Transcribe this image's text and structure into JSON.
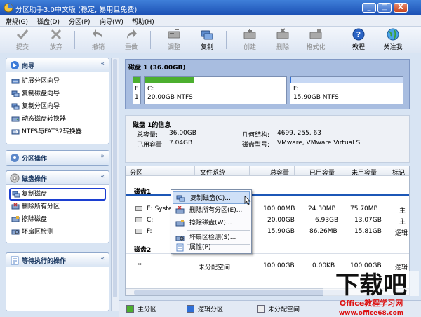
{
  "window": {
    "title": "分区助手3.0中文版 (稳定, 易用且免费)",
    "controls": [
      "_",
      "□",
      "X"
    ]
  },
  "menu": [
    "常规(G)",
    "磁盘(D)",
    "分区(P)",
    "向导(W)",
    "帮助(H)"
  ],
  "toolbar": [
    {
      "label": "提交",
      "icon": "check-icon",
      "enabled": false
    },
    {
      "label": "放弃",
      "icon": "x-icon",
      "enabled": false
    },
    {
      "label": "撤销",
      "icon": "undo-icon",
      "enabled": false
    },
    {
      "label": "重做",
      "icon": "redo-icon",
      "enabled": false
    },
    {
      "label": "调整",
      "icon": "resize-disk-icon",
      "enabled": false
    },
    {
      "label": "复制",
      "icon": "copy-disk-icon",
      "enabled": true
    },
    {
      "label": "创建",
      "icon": "create-disk-icon",
      "enabled": false
    },
    {
      "label": "删除",
      "icon": "delete-disk-icon",
      "enabled": false
    },
    {
      "label": "格式化",
      "icon": "format-disk-icon",
      "enabled": false
    },
    {
      "label": "教程",
      "icon": "help-icon",
      "enabled": true
    },
    {
      "label": "关注我",
      "icon": "globe-icon",
      "enabled": true
    }
  ],
  "left_panels": {
    "wizard": {
      "title": "向导",
      "chevron": "«",
      "items": [
        "扩展分区向导",
        "复制磁盘向导",
        "复制分区向导",
        "动态磁盘转换器",
        "NTFS与FAT32转换器"
      ]
    },
    "partition_ops": {
      "title": "分区操作",
      "chevron": "»"
    },
    "disk_ops": {
      "title": "磁盘操作",
      "chevron": "«",
      "items": [
        "复制磁盘",
        "删除所有分区",
        "擦除磁盘",
        "坏扇区检测"
      ],
      "selected": "复制磁盘"
    },
    "pending": {
      "title": "等待执行的操作",
      "chevron": "«"
    }
  },
  "disk_map": {
    "header": "磁盘 1 (36.00GB)",
    "small_part": {
      "letter": "E",
      "num": "1"
    },
    "c_part": {
      "name": "C:",
      "detail": "20.00GB NTFS",
      "used_fraction": 0.35
    },
    "f_part": {
      "name": "F:",
      "detail": "15.90GB NTFS",
      "used_fraction": 0.005
    }
  },
  "info": {
    "title": "磁盘 1的信息",
    "total_label": "总容量:",
    "total": "36.00GB",
    "used_label": "已用容量:",
    "used": "7.04GB",
    "geom_label": "几何结构:",
    "geom": "4699, 255, 63",
    "model_label": "磁盘型号:",
    "model": "VMware, VMware Virtual S"
  },
  "grid": {
    "headers": [
      "分区",
      "文件系统",
      "总容量",
      "已用容量",
      "未用容量",
      "标记"
    ],
    "group1": "磁盘1",
    "rows": [
      {
        "part": "E:  System",
        "fs": "",
        "total": "100.00MB",
        "used": "24.30MB",
        "free": "75.70MB",
        "flag": "主"
      },
      {
        "part": "C:",
        "fs": "",
        "total": "20.00GB",
        "used": "6.93GB",
        "free": "13.07GB",
        "flag": "主"
      },
      {
        "part": "F:",
        "fs": "",
        "total": "15.90GB",
        "used": "86.26MB",
        "free": "15.81GB",
        "flag": "逻辑"
      }
    ],
    "group2": "磁盘2",
    "rows2": [
      {
        "part": "*",
        "fs": "未分配空间",
        "total": "100.00GB",
        "used": "0.00KB",
        "free": "100.00GB",
        "flag": "逻辑"
      }
    ]
  },
  "context_menu": [
    {
      "label": "复制磁盘(C)...",
      "icon": "copy-disk-icon",
      "highlighted": true
    },
    {
      "label": "删除所有分区(E)...",
      "icon": "delete-disk-icon",
      "highlighted": false
    },
    {
      "label": "擦除磁盘(W)...",
      "icon": "wipe-disk-icon",
      "highlighted": false
    },
    {
      "label": "坏扇区检测(S)...",
      "icon": "scan-disk-icon",
      "highlighted": false
    },
    {
      "label": "属性(P)",
      "icon": "properties-icon",
      "highlighted": false
    }
  ],
  "legend": [
    "主分区",
    "逻辑分区",
    "未分配空间"
  ],
  "watermark": {
    "logo": "下载吧",
    "site": "Office教程学习网",
    "url": "www.office68.com"
  },
  "colors": {
    "primary": "#4caf2f",
    "logical": "#2f6fd6",
    "unallocated": "#ededed",
    "accent": "#1c57b7"
  }
}
